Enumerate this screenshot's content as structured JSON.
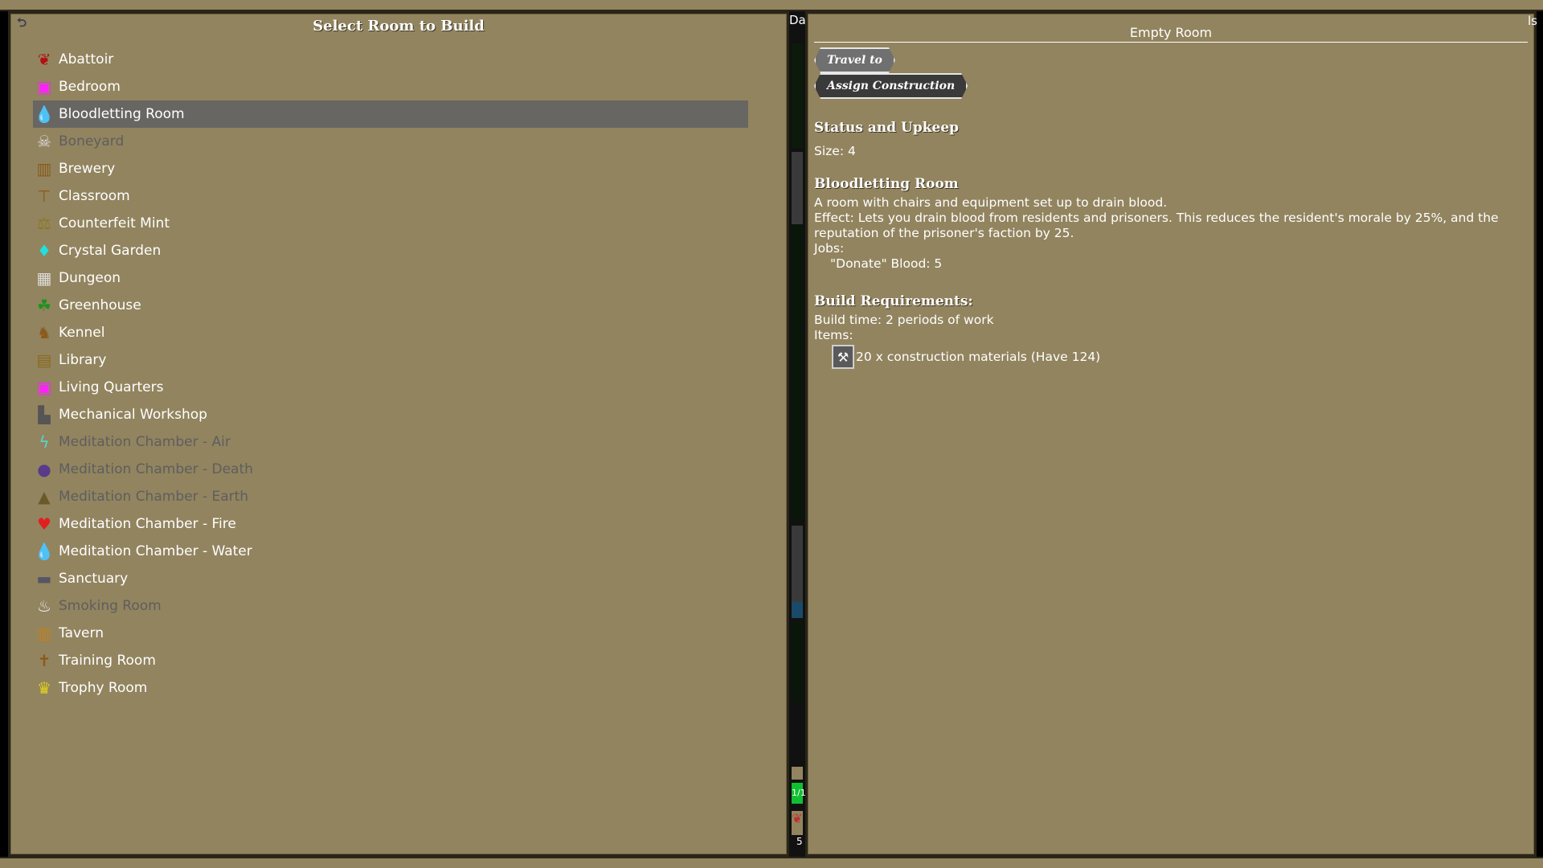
{
  "left_panel": {
    "title": "Select Room to Build",
    "rooms": [
      {
        "label": "Abattoir",
        "icon": "blood-splat-icon",
        "glyph": "❦",
        "color": "#b01010",
        "dim": false,
        "selected": false
      },
      {
        "label": "Bedroom",
        "icon": "bed-icon",
        "glyph": "▣",
        "color": "#ff20ff",
        "dim": false,
        "selected": false
      },
      {
        "label": "Bloodletting Room",
        "icon": "blood-drops-icon",
        "glyph": "💧",
        "color": "#d01010",
        "dim": false,
        "selected": true
      },
      {
        "label": "Boneyard",
        "icon": "bones-icon",
        "glyph": "☠",
        "color": "#dddddd",
        "dim": true,
        "selected": false
      },
      {
        "label": "Brewery",
        "icon": "barrel-icon",
        "glyph": "▥",
        "color": "#8a5a1a",
        "dim": false,
        "selected": false
      },
      {
        "label": "Classroom",
        "icon": "lectern-icon",
        "glyph": "⊤",
        "color": "#8a5a1a",
        "dim": false,
        "selected": false
      },
      {
        "label": "Counterfeit Mint",
        "icon": "mint-press-icon",
        "glyph": "⚖",
        "color": "#8a7a1a",
        "dim": false,
        "selected": false
      },
      {
        "label": "Crystal Garden",
        "icon": "crystal-icon",
        "glyph": "♦",
        "color": "#20e0e0",
        "dim": false,
        "selected": false
      },
      {
        "label": "Dungeon",
        "icon": "cell-bars-icon",
        "glyph": "▦",
        "color": "#dddddd",
        "dim": false,
        "selected": false
      },
      {
        "label": "Greenhouse",
        "icon": "plant-icon",
        "glyph": "☘",
        "color": "#209020",
        "dim": false,
        "selected": false
      },
      {
        "label": "Kennel",
        "icon": "hound-icon",
        "glyph": "♞",
        "color": "#8a5a1a",
        "dim": false,
        "selected": false
      },
      {
        "label": "Library",
        "icon": "bookshelf-icon",
        "glyph": "▤",
        "color": "#8a6a1a",
        "dim": false,
        "selected": false
      },
      {
        "label": "Living Quarters",
        "icon": "bed-icon",
        "glyph": "▣",
        "color": "#ff20ff",
        "dim": false,
        "selected": false
      },
      {
        "label": "Mechanical Workshop",
        "icon": "workbench-icon",
        "glyph": "▙",
        "color": "#555555",
        "dim": false,
        "selected": false
      },
      {
        "label": "Meditation Chamber - Air",
        "icon": "lightning-icon",
        "glyph": "ϟ",
        "color": "#60d0d0",
        "dim": true,
        "selected": false
      },
      {
        "label": "Meditation Chamber - Death",
        "icon": "skull-icon",
        "glyph": "●",
        "color": "#5a3a8a",
        "dim": true,
        "selected": false
      },
      {
        "label": "Meditation Chamber - Earth",
        "icon": "mountain-icon",
        "glyph": "▲",
        "color": "#6a5a2a",
        "dim": true,
        "selected": false
      },
      {
        "label": "Meditation Chamber - Fire",
        "icon": "fire-heart-icon",
        "glyph": "♥",
        "color": "#e02020",
        "dim": false,
        "selected": false
      },
      {
        "label": "Meditation Chamber - Water",
        "icon": "water-drop-icon",
        "glyph": "💧",
        "color": "#1a70d0",
        "dim": false,
        "selected": false
      },
      {
        "label": "Sanctuary",
        "icon": "altar-icon",
        "glyph": "▬",
        "color": "#555566",
        "dim": false,
        "selected": false
      },
      {
        "label": "Smoking Room",
        "icon": "hookah-icon",
        "glyph": "♨",
        "color": "#eeeeee",
        "dim": true,
        "selected": false
      },
      {
        "label": "Tavern",
        "icon": "mug-icon",
        "glyph": "▥",
        "color": "#c08020",
        "dim": false,
        "selected": false
      },
      {
        "label": "Training Room",
        "icon": "training-dummy-icon",
        "glyph": "✝",
        "color": "#8a5a1a",
        "dim": false,
        "selected": false
      },
      {
        "label": "Trophy Room",
        "icon": "trophy-icon",
        "glyph": "♛",
        "color": "#e0d020",
        "dim": false,
        "selected": false
      }
    ]
  },
  "right_panel": {
    "header": "Empty Room",
    "buttons": {
      "travel": "Travel to",
      "assign": "Assign Construction"
    },
    "status_title": "Status and Upkeep",
    "size_text": "Size: 4",
    "room_title": "Bloodletting Room",
    "description": "A room with chairs and equipment set up to drain blood.",
    "effect_line1": "Effect: Lets you drain blood from residents and prisoners. This reduces the resident's morale by 25%, and the",
    "effect_line2": "reputation of the prisoner's faction by 25.",
    "jobs_label": "Jobs:",
    "job_entry": "\"Donate\" Blood: 5",
    "build_title": "Build Requirements:",
    "build_time": "Build time: 2 periods of work",
    "items_label": "Items:",
    "item_entry": "20 x construction materials (Have 124)",
    "item_icon": "hammer-icon"
  },
  "divider": {
    "top_label": "Da",
    "right_edge_label": "ls",
    "counter_label": "1/1",
    "bottom_label": "5"
  },
  "colors": {
    "panel_bg": "#92845f",
    "selected_row": "#686663",
    "dim_text": "#5e5e5e"
  }
}
